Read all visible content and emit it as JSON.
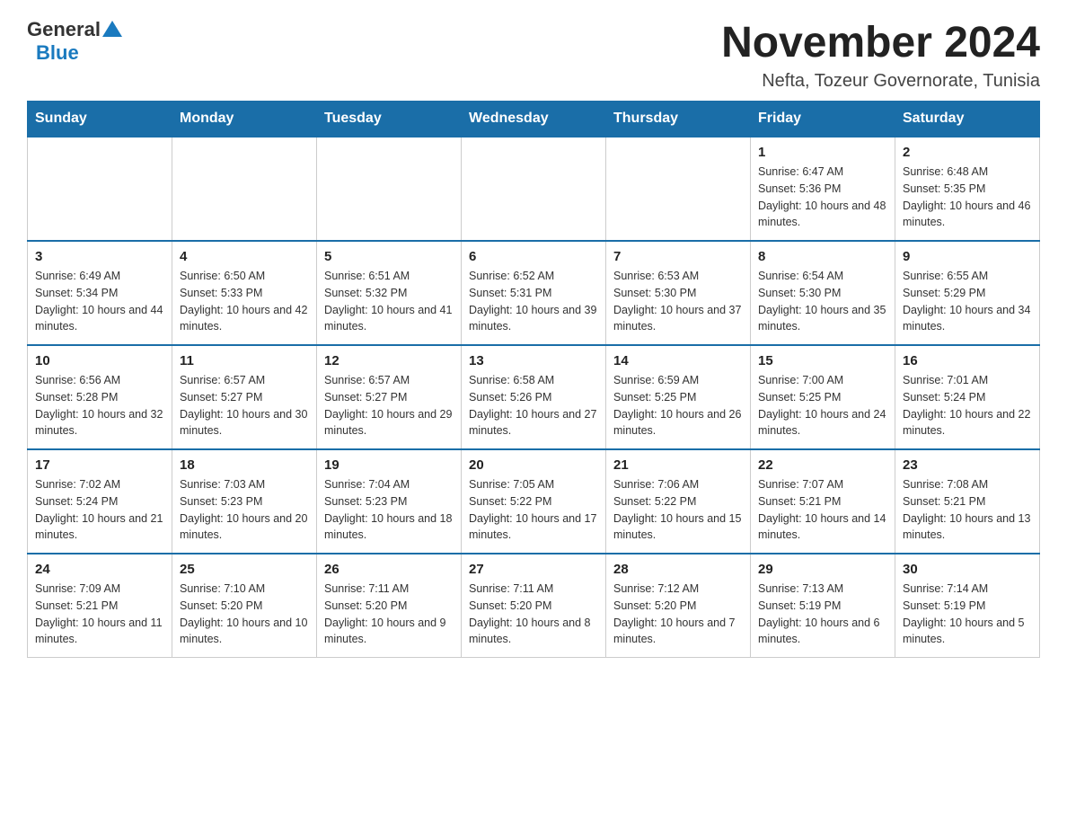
{
  "header": {
    "logo_general": "General",
    "logo_blue": "Blue",
    "month_title": "November 2024",
    "subtitle": "Nefta, Tozeur Governorate, Tunisia"
  },
  "days_of_week": [
    "Sunday",
    "Monday",
    "Tuesday",
    "Wednesday",
    "Thursday",
    "Friday",
    "Saturday"
  ],
  "weeks": [
    [
      {
        "day": "",
        "info": ""
      },
      {
        "day": "",
        "info": ""
      },
      {
        "day": "",
        "info": ""
      },
      {
        "day": "",
        "info": ""
      },
      {
        "day": "",
        "info": ""
      },
      {
        "day": "1",
        "info": "Sunrise: 6:47 AM\nSunset: 5:36 PM\nDaylight: 10 hours and 48 minutes."
      },
      {
        "day": "2",
        "info": "Sunrise: 6:48 AM\nSunset: 5:35 PM\nDaylight: 10 hours and 46 minutes."
      }
    ],
    [
      {
        "day": "3",
        "info": "Sunrise: 6:49 AM\nSunset: 5:34 PM\nDaylight: 10 hours and 44 minutes."
      },
      {
        "day": "4",
        "info": "Sunrise: 6:50 AM\nSunset: 5:33 PM\nDaylight: 10 hours and 42 minutes."
      },
      {
        "day": "5",
        "info": "Sunrise: 6:51 AM\nSunset: 5:32 PM\nDaylight: 10 hours and 41 minutes."
      },
      {
        "day": "6",
        "info": "Sunrise: 6:52 AM\nSunset: 5:31 PM\nDaylight: 10 hours and 39 minutes."
      },
      {
        "day": "7",
        "info": "Sunrise: 6:53 AM\nSunset: 5:30 PM\nDaylight: 10 hours and 37 minutes."
      },
      {
        "day": "8",
        "info": "Sunrise: 6:54 AM\nSunset: 5:30 PM\nDaylight: 10 hours and 35 minutes."
      },
      {
        "day": "9",
        "info": "Sunrise: 6:55 AM\nSunset: 5:29 PM\nDaylight: 10 hours and 34 minutes."
      }
    ],
    [
      {
        "day": "10",
        "info": "Sunrise: 6:56 AM\nSunset: 5:28 PM\nDaylight: 10 hours and 32 minutes."
      },
      {
        "day": "11",
        "info": "Sunrise: 6:57 AM\nSunset: 5:27 PM\nDaylight: 10 hours and 30 minutes."
      },
      {
        "day": "12",
        "info": "Sunrise: 6:57 AM\nSunset: 5:27 PM\nDaylight: 10 hours and 29 minutes."
      },
      {
        "day": "13",
        "info": "Sunrise: 6:58 AM\nSunset: 5:26 PM\nDaylight: 10 hours and 27 minutes."
      },
      {
        "day": "14",
        "info": "Sunrise: 6:59 AM\nSunset: 5:25 PM\nDaylight: 10 hours and 26 minutes."
      },
      {
        "day": "15",
        "info": "Sunrise: 7:00 AM\nSunset: 5:25 PM\nDaylight: 10 hours and 24 minutes."
      },
      {
        "day": "16",
        "info": "Sunrise: 7:01 AM\nSunset: 5:24 PM\nDaylight: 10 hours and 22 minutes."
      }
    ],
    [
      {
        "day": "17",
        "info": "Sunrise: 7:02 AM\nSunset: 5:24 PM\nDaylight: 10 hours and 21 minutes."
      },
      {
        "day": "18",
        "info": "Sunrise: 7:03 AM\nSunset: 5:23 PM\nDaylight: 10 hours and 20 minutes."
      },
      {
        "day": "19",
        "info": "Sunrise: 7:04 AM\nSunset: 5:23 PM\nDaylight: 10 hours and 18 minutes."
      },
      {
        "day": "20",
        "info": "Sunrise: 7:05 AM\nSunset: 5:22 PM\nDaylight: 10 hours and 17 minutes."
      },
      {
        "day": "21",
        "info": "Sunrise: 7:06 AM\nSunset: 5:22 PM\nDaylight: 10 hours and 15 minutes."
      },
      {
        "day": "22",
        "info": "Sunrise: 7:07 AM\nSunset: 5:21 PM\nDaylight: 10 hours and 14 minutes."
      },
      {
        "day": "23",
        "info": "Sunrise: 7:08 AM\nSunset: 5:21 PM\nDaylight: 10 hours and 13 minutes."
      }
    ],
    [
      {
        "day": "24",
        "info": "Sunrise: 7:09 AM\nSunset: 5:21 PM\nDaylight: 10 hours and 11 minutes."
      },
      {
        "day": "25",
        "info": "Sunrise: 7:10 AM\nSunset: 5:20 PM\nDaylight: 10 hours and 10 minutes."
      },
      {
        "day": "26",
        "info": "Sunrise: 7:11 AM\nSunset: 5:20 PM\nDaylight: 10 hours and 9 minutes."
      },
      {
        "day": "27",
        "info": "Sunrise: 7:11 AM\nSunset: 5:20 PM\nDaylight: 10 hours and 8 minutes."
      },
      {
        "day": "28",
        "info": "Sunrise: 7:12 AM\nSunset: 5:20 PM\nDaylight: 10 hours and 7 minutes."
      },
      {
        "day": "29",
        "info": "Sunrise: 7:13 AM\nSunset: 5:19 PM\nDaylight: 10 hours and 6 minutes."
      },
      {
        "day": "30",
        "info": "Sunrise: 7:14 AM\nSunset: 5:19 PM\nDaylight: 10 hours and 5 minutes."
      }
    ]
  ]
}
